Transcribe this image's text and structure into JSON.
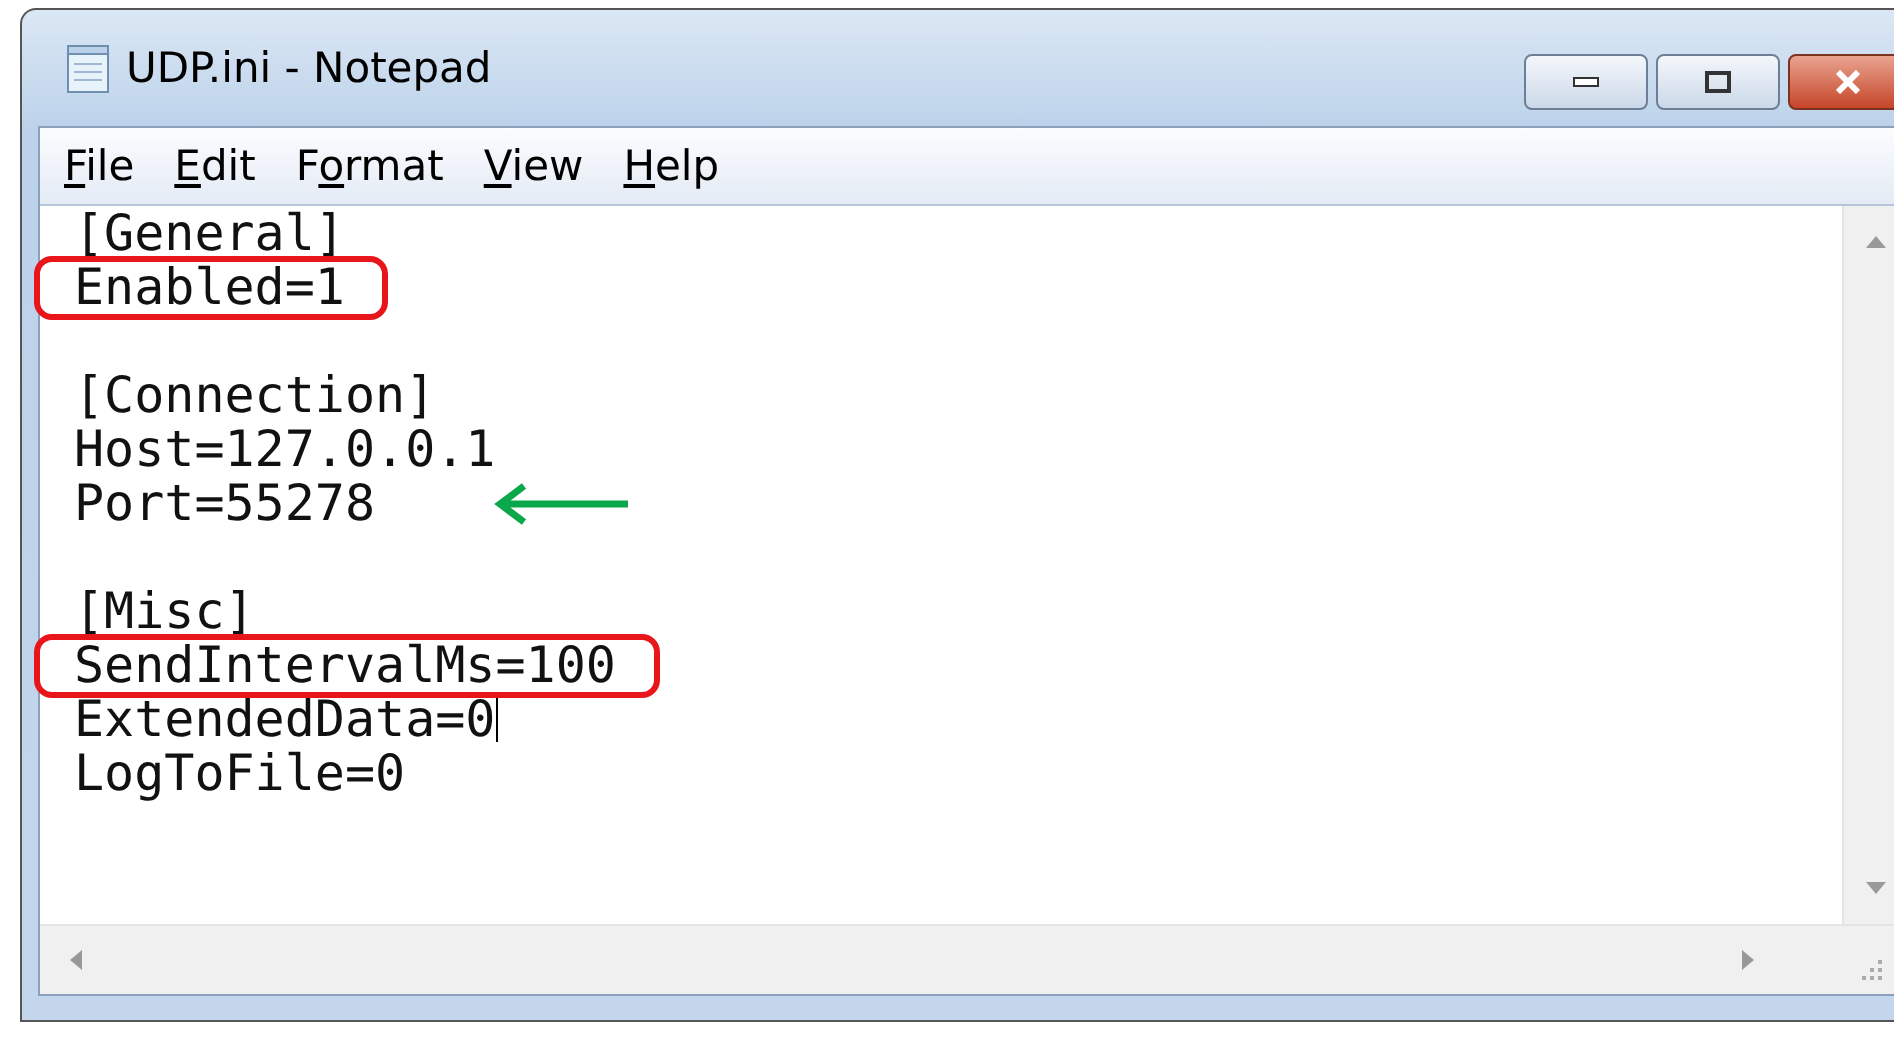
{
  "window": {
    "title": "UDP.ini - Notepad"
  },
  "menu": [
    {
      "key": "F",
      "post": "ile"
    },
    {
      "key": "E",
      "post": "dit"
    },
    {
      "pre": "F",
      "key": "o",
      "post": "rmat"
    },
    {
      "key": "V",
      "post": "iew"
    },
    {
      "key": "H",
      "post": "elp"
    }
  ],
  "editor": {
    "lines": [
      {
        "text": "[General]",
        "highlighted": false,
        "arrow": false,
        "caret": false
      },
      {
        "text": "Enabled=1",
        "highlighted": true,
        "arrow": false,
        "caret": false
      },
      {
        "highlighted": false,
        "arrow": false,
        "caret": false
      },
      {
        "text": "[Connection]",
        "highlighted": false,
        "arrow": false,
        "caret": false
      },
      {
        "text": "Host=127.0.0.1",
        "highlighted": false,
        "arrow": false,
        "caret": false
      },
      {
        "text": "Port=55278",
        "highlighted": false,
        "arrow": true,
        "caret": false
      },
      {
        "highlighted": false,
        "arrow": false,
        "caret": false
      },
      {
        "text": "[Misc]",
        "highlighted": false,
        "arrow": false,
        "caret": false
      },
      {
        "text": "SendIntervalMs=100",
        "highlighted": true,
        "arrow": false,
        "caret": false
      },
      {
        "text": "ExtendedData=0",
        "highlighted": false,
        "arrow": false,
        "caret": true
      },
      {
        "text": "LogToFile=0",
        "highlighted": false,
        "arrow": false,
        "caret": false
      }
    ]
  }
}
